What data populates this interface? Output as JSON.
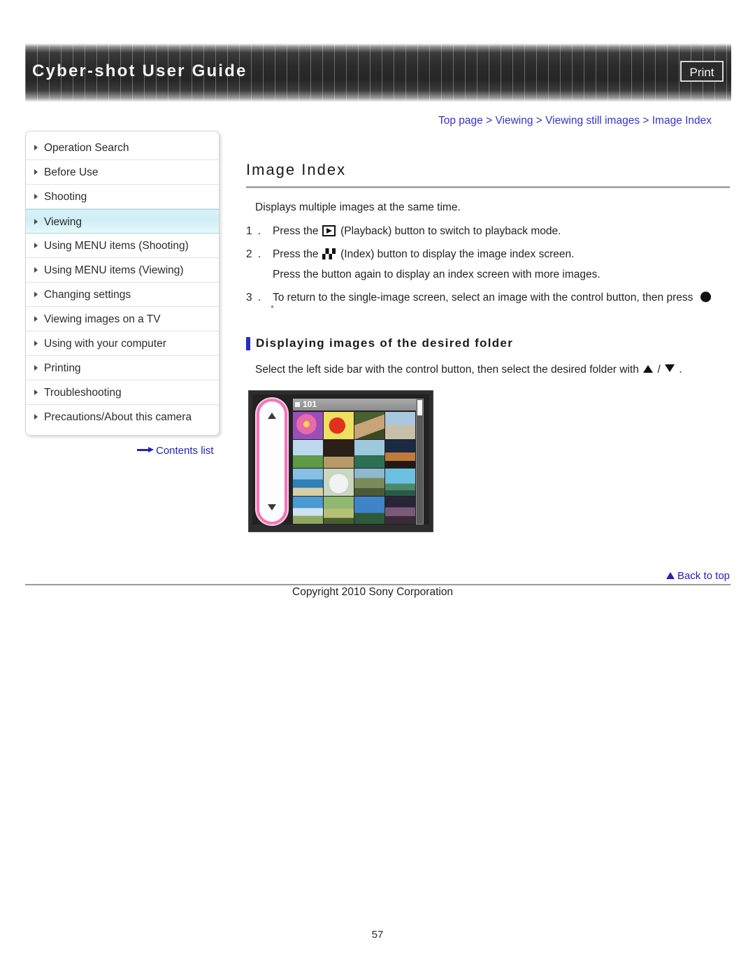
{
  "header": {
    "title": "Cyber-shot User Guide",
    "print_label": "Print"
  },
  "breadcrumb": {
    "text": "Top page > Viewing > Viewing still images > Image Index"
  },
  "sidebar": {
    "items": [
      {
        "label": "Operation Search",
        "active": false
      },
      {
        "label": "Before Use",
        "active": false
      },
      {
        "label": "Shooting",
        "active": false
      },
      {
        "label": "Viewing",
        "active": true
      },
      {
        "label": "Using MENU items (Shooting)",
        "active": false
      },
      {
        "label": "Using MENU items (Viewing)",
        "active": false
      },
      {
        "label": "Changing settings",
        "active": false
      },
      {
        "label": "Viewing images on a TV",
        "active": false
      },
      {
        "label": "Using with your computer",
        "active": false
      },
      {
        "label": "Printing",
        "active": false
      },
      {
        "label": "Troubleshooting",
        "active": false
      },
      {
        "label": "Precautions/About this camera",
        "active": false
      }
    ],
    "contents_link": "Contents list"
  },
  "main": {
    "title": "Image Index",
    "intro": "Displays multiple images at the same time.",
    "steps": [
      {
        "num": "1 .",
        "pre": "Press the",
        "icon": "playback-icon",
        "post": "(Playback) button to switch to playback mode.",
        "extra": ""
      },
      {
        "num": "2 .",
        "pre": "Press the",
        "icon": "index-icon",
        "post": "(Index) button to display the image index screen.",
        "extra": "Press the button again to display an index screen with more images."
      },
      {
        "num": "3 .",
        "pre": "To return to the single-image screen, select an image with the control button, then press",
        "icon": "filled-circle-icon",
        "post": "",
        "extra": ""
      }
    ],
    "stray_period": ".",
    "subsection": {
      "heading": "Displaying images of the desired folder",
      "text_before": "Select the left side bar with the control button, then select the desired folder with",
      "separator": "/",
      "text_after": "."
    }
  },
  "illustration": {
    "folder_label": "101",
    "thumbnails": [
      "#b96fc8",
      "#e0e05a",
      "#5c6a4a",
      "#7fa7c2",
      "#6f9bd0",
      "#3b3027",
      "#3f7fa8",
      "#2a3c5a",
      "#5fa9d8",
      "#d8d8d8",
      "#8a9a7a",
      "#59b8d8",
      "#4a9ad4",
      "#7aa84a",
      "#2f6fb0",
      "#4a3050"
    ]
  },
  "footer": {
    "back_to_top": "Back to top",
    "copyright": "Copyright 2010 Sony Corporation",
    "page_number": "57"
  },
  "colors": {
    "link": "#3333cc",
    "accent_bar": "#2b2bbf",
    "active_nav": "#cfeef6",
    "highlight_pink": "#f573b9"
  }
}
